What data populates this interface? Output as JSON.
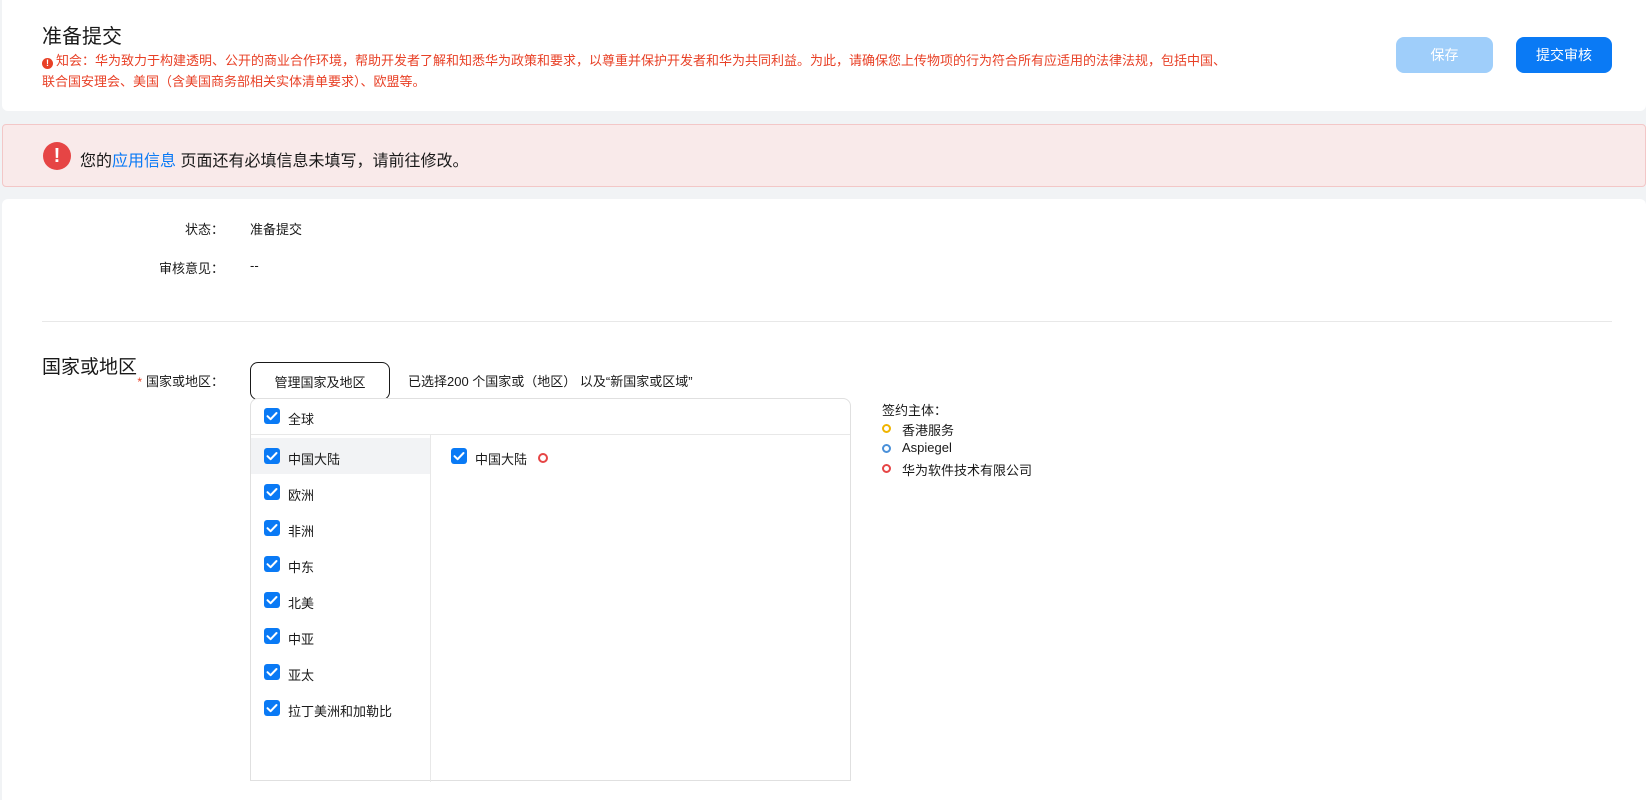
{
  "header": {
    "title": "准备提交",
    "notice": "知会：华为致力于构建透明、公开的商业合作环境，帮助开发者了解和知悉华为政策和要求，以尊重并保护开发者和华为共同利益。为此，请确保您上传物项的行为符合所有应适用的法律法规，包括中国、联合国安理会、美国（含美国商务部相关实体清单要求）、欧盟等。",
    "save_label": "保存",
    "submit_label": "提交审核"
  },
  "alert": {
    "prefix": "您的",
    "link": "应用信息",
    "suffix": " 页面还有必填信息未填写，请前往修改。"
  },
  "status": {
    "label": "状态：",
    "value": "准备提交",
    "review_label": "审核意见：",
    "review_value": "--"
  },
  "region": {
    "section_title": "国家或地区",
    "required_mark": "*",
    "field_label": "国家或地区：",
    "manage_button": "管理国家及地区",
    "selected_summary": "已选择200 个国家或（地区） 以及“新国家或区域”",
    "global_label": "全球",
    "left_items": [
      {
        "label": "中国大陆",
        "checked": true
      },
      {
        "label": "欧洲",
        "checked": true
      },
      {
        "label": "非洲",
        "checked": true
      },
      {
        "label": "中东",
        "checked": true
      },
      {
        "label": "北美",
        "checked": true
      },
      {
        "label": "中亚",
        "checked": true
      },
      {
        "label": "亚太",
        "checked": true
      },
      {
        "label": "拉丁美洲和加勒比",
        "checked": true
      }
    ],
    "right_items": [
      {
        "label": "中国大陆",
        "checked": true,
        "entity_color": "#e64545"
      }
    ]
  },
  "legend": {
    "title": "签约主体：",
    "items": [
      {
        "label": "香港服务",
        "color": "#f0b400"
      },
      {
        "label": "Aspiegel",
        "color": "#4a90d9"
      },
      {
        "label": "华为软件技术有限公司",
        "color": "#e64545"
      }
    ]
  },
  "colors": {
    "accent": "#0a7af5",
    "error": "#e84026"
  }
}
